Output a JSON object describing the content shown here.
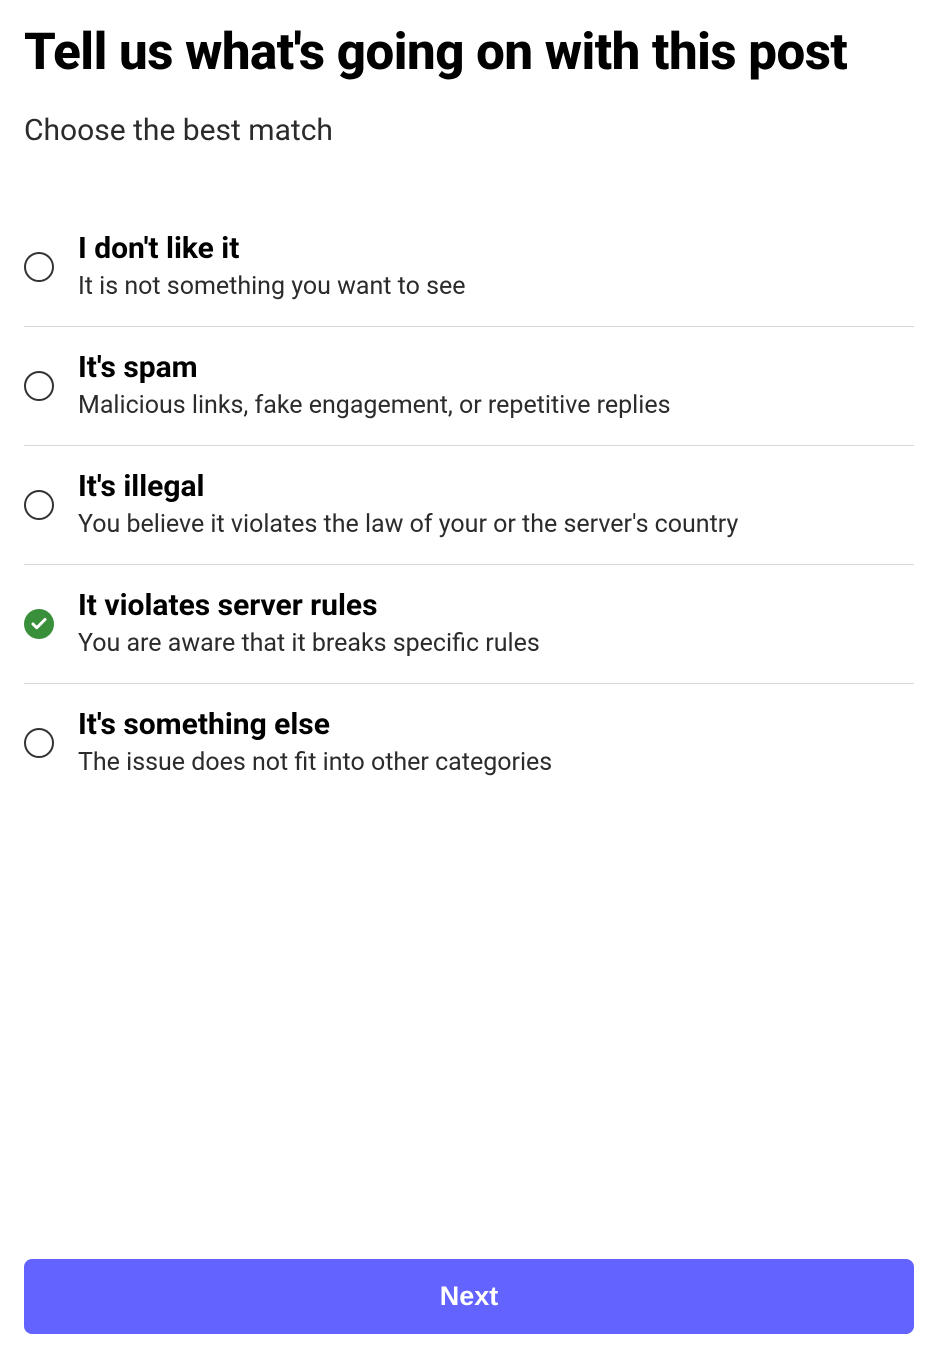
{
  "header": {
    "title": "Tell us what's going on with this post",
    "subtitle": "Choose the best match"
  },
  "options": [
    {
      "id": "dont-like",
      "title": "I don't like it",
      "desc": "It is not something you want to see",
      "selected": false
    },
    {
      "id": "spam",
      "title": "It's spam",
      "desc": "Malicious links, fake engagement, or repetitive replies",
      "selected": false
    },
    {
      "id": "illegal",
      "title": "It's illegal",
      "desc": "You believe it violates the law of your or the server's country",
      "selected": false
    },
    {
      "id": "violates-rules",
      "title": "It violates server rules",
      "desc": "You are aware that it breaks specific rules",
      "selected": true
    },
    {
      "id": "something-else",
      "title": "It's something else",
      "desc": "The issue does not fit into other categories",
      "selected": false
    }
  ],
  "footer": {
    "next_label": "Next"
  },
  "colors": {
    "primary": "#6364ff",
    "selected_radio": "#3a8f3a"
  }
}
